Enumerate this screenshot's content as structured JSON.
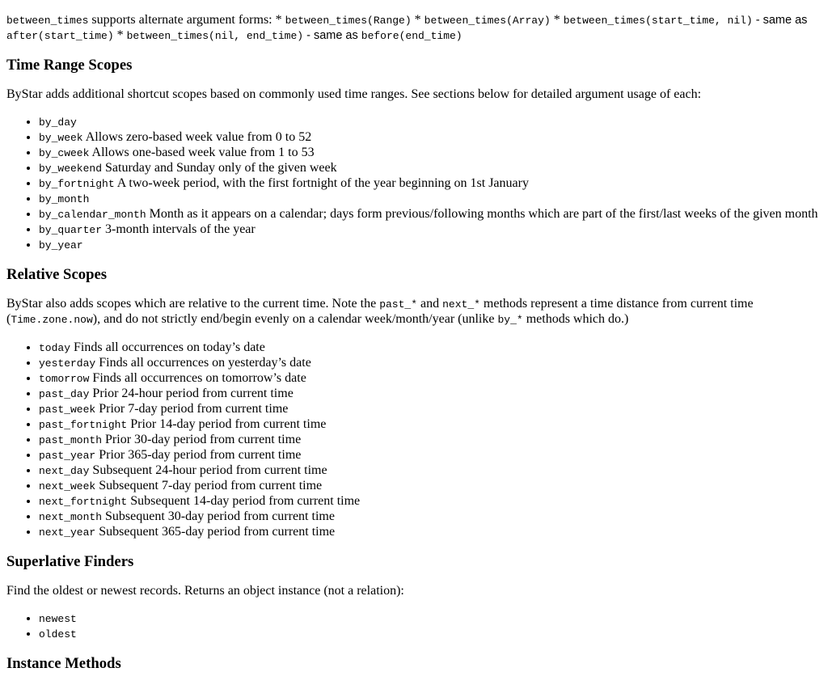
{
  "intro": {
    "code1": "between_times",
    "text1": " supports alternate argument forms: * ",
    "code2": "between_times(Range)",
    "text2": " * ",
    "code3": "between_times(Array)",
    "text3": " * ",
    "code4": "between_times(start_time, nil)",
    "text4": " - same as ",
    "code5": "after(start_time)",
    "text5": " * ",
    "code6": "between_times(nil, end_time)",
    "text6": " - same as ",
    "code7": "before(end_time)"
  },
  "time_range": {
    "heading": "Time Range Scopes",
    "desc": "ByStar adds additional shortcut scopes based on commonly used time ranges. See sections below for detailed argument usage of each:",
    "items": [
      {
        "code": "by_day",
        "text": ""
      },
      {
        "code": "by_week",
        "text": " Allows zero-based week value from 0 to 52"
      },
      {
        "code": "by_cweek",
        "text": " Allows one-based week value from 1 to 53"
      },
      {
        "code": "by_weekend",
        "text": " Saturday and Sunday only of the given week"
      },
      {
        "code": "by_fortnight",
        "text": " A two-week period, with the first fortnight of the year beginning on 1st January"
      },
      {
        "code": "by_month",
        "text": ""
      },
      {
        "code": "by_calendar_month",
        "text": " Month as it appears on a calendar; days form previous/following months which are part of the first/last weeks of the given month"
      },
      {
        "code": "by_quarter",
        "text": " 3-month intervals of the year"
      },
      {
        "code": "by_year",
        "text": ""
      }
    ]
  },
  "relative": {
    "heading": "Relative Scopes",
    "desc1": "ByStar also adds scopes which are relative to the current time. Note the ",
    "code1": "past_*",
    "desc2": " and ",
    "code2": "next_*",
    "desc3": " methods represent a time distance from current time (",
    "code3": "Time.zone.now",
    "desc4": "), and do not strictly end/begin evenly on a calendar week/month/year (unlike ",
    "code4": "by_*",
    "desc5": " methods which do.)",
    "items": [
      {
        "code": "today",
        "text": " Finds all occurrences on today’s date"
      },
      {
        "code": "yesterday",
        "text": " Finds all occurrences on yesterday’s date"
      },
      {
        "code": "tomorrow",
        "text": " Finds all occurrences on tomorrow’s date"
      },
      {
        "code": "past_day",
        "text": " Prior 24-hour period from current time"
      },
      {
        "code": "past_week",
        "text": " Prior 7-day period from current time"
      },
      {
        "code": "past_fortnight",
        "text": " Prior 14-day period from current time"
      },
      {
        "code": "past_month",
        "text": " Prior 30-day period from current time"
      },
      {
        "code": "past_year",
        "text": " Prior 365-day period from current time"
      },
      {
        "code": "next_day",
        "text": " Subsequent 24-hour period from current time"
      },
      {
        "code": "next_week",
        "text": " Subsequent 7-day period from current time"
      },
      {
        "code": "next_fortnight",
        "text": " Subsequent 14-day period from current time"
      },
      {
        "code": "next_month",
        "text": " Subsequent 30-day period from current time"
      },
      {
        "code": "next_year",
        "text": " Subsequent 365-day period from current time"
      }
    ]
  },
  "superlative": {
    "heading": "Superlative Finders",
    "desc": "Find the oldest or newest records. Returns an object instance (not a relation):",
    "items": [
      {
        "code": "newest",
        "text": ""
      },
      {
        "code": "oldest",
        "text": ""
      }
    ]
  },
  "instance": {
    "heading": "Instance Methods"
  }
}
